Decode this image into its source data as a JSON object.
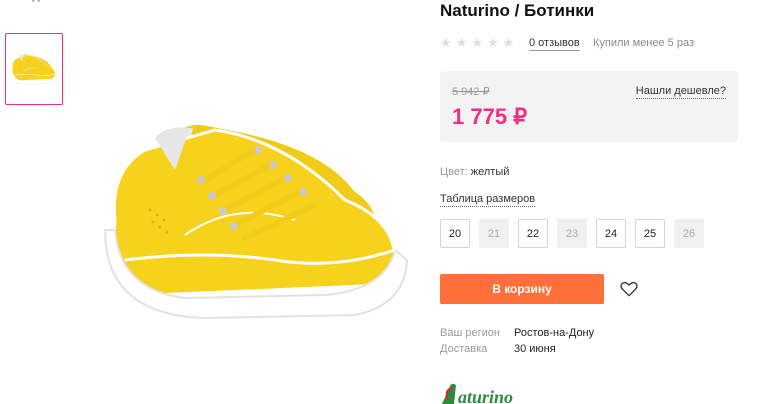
{
  "product": {
    "title": "Naturino / Ботинки",
    "rating_stars": 5,
    "reviews_label": "0 отзывов",
    "bought_label": "Купили менее 5 раз"
  },
  "price": {
    "old": "5 942 ₽",
    "current": "1 775 ₽",
    "cheaper_link": "Нашли дешевле?"
  },
  "color": {
    "label": "Цвет:",
    "value": "желтый"
  },
  "size_table_link": "Таблица размеров",
  "sizes": [
    {
      "label": "20",
      "available": true
    },
    {
      "label": "21",
      "available": false
    },
    {
      "label": "22",
      "available": true
    },
    {
      "label": "23",
      "available": false
    },
    {
      "label": "24",
      "available": true
    },
    {
      "label": "25",
      "available": true
    },
    {
      "label": "26",
      "available": false
    }
  ],
  "cart_button": "В корзину",
  "delivery": {
    "region_label": "Ваш регион",
    "region_value": "Ростов-на-Дону",
    "delivery_label": "Доставка",
    "delivery_value": "30 июня"
  },
  "brand_logo": "Naturino",
  "colors": {
    "accent_pink": "#f52d7e",
    "button_orange": "#ff7038",
    "shoe_yellow": "#f5d21c",
    "logo_green": "#2e8b3e",
    "logo_red": "#d9262b"
  }
}
